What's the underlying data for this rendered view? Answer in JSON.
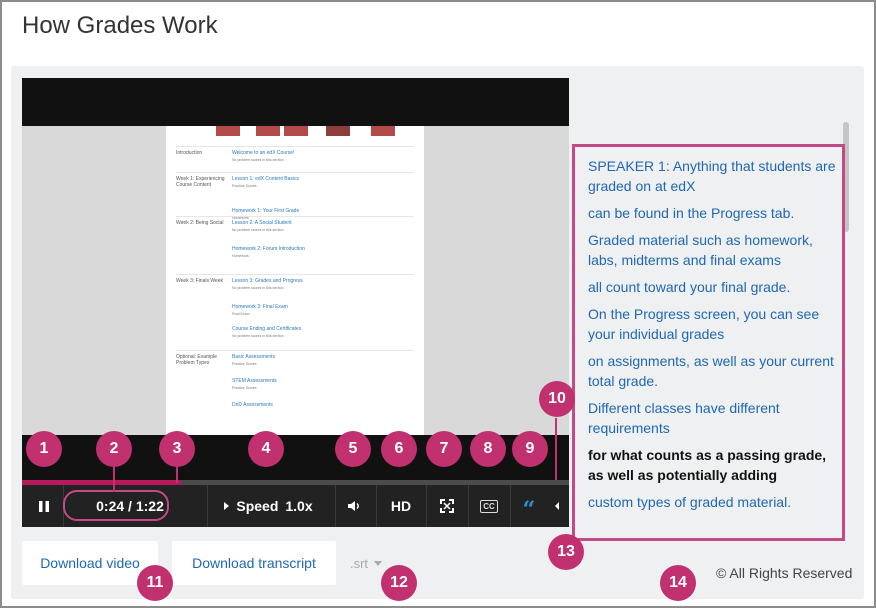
{
  "page": {
    "title": "How Grades Work"
  },
  "video": {
    "page_rows": [
      {
        "section": "Introduction",
        "link": "Welcome to an edX Course!",
        "sub": "No problem scores in this section"
      },
      {
        "section": "Week 1: Experiencing Course Content",
        "link": "Lesson 1: edX Content Basics",
        "sub": "Practice Scores"
      },
      {
        "section": "",
        "link": "Homework 1: Your First Grade",
        "sub": "Homework"
      },
      {
        "section": "Week 2: Being Social",
        "link": "Lesson 2: A Social Student",
        "sub": "No problem scores in this section"
      },
      {
        "section": "",
        "link": "Homework 2: Forum Introduction",
        "sub": "Homework"
      },
      {
        "section": "Week 3: Finals Week",
        "link": "Lesson 3: Grades and Progress",
        "sub": "No problem scores in this section"
      },
      {
        "section": "",
        "link": "Homework 3: Final Exam",
        "sub": "Final Exam"
      },
      {
        "section": "",
        "link": "Course Ending and Certificates",
        "sub": "No problem scores in this section"
      },
      {
        "section": "Optional: Example Problem Types",
        "link": "Basic Assessments",
        "sub": "Practice Scores"
      },
      {
        "section": "",
        "link": "STEM Assessments",
        "sub": "Practice Scores"
      },
      {
        "section": "",
        "link": "DnD Assessments",
        "sub": ""
      }
    ]
  },
  "player": {
    "progress": 0.29,
    "time_display": "0:24 / 1:22",
    "speed_label": "Speed",
    "speed_value": "1.0x",
    "hd_label": "HD",
    "cc_label": "CC",
    "quote_glyph": "“",
    "icons": [
      "pause-icon",
      "volume-icon",
      "fullscreen-icon",
      "chevron-left-icon"
    ]
  },
  "transcript": {
    "lines": [
      {
        "text": "SPEAKER 1: Anything that students are graded on at edX",
        "active": false
      },
      {
        "text": "can be found in the Progress tab.",
        "active": false
      },
      {
        "text": "Graded material such as homework, labs, midterms and final exams",
        "active": false
      },
      {
        "text": "all count toward your final grade.",
        "active": false
      },
      {
        "text": "On the Progress screen, you can see your individual grades",
        "active": false
      },
      {
        "text": "on assignments, as well as your current total grade.",
        "active": false
      },
      {
        "text": "Different classes have different requirements",
        "active": false
      },
      {
        "text": "for what counts as a passing grade, as well as potentially adding",
        "active": true
      },
      {
        "text": "custom types of graded material.",
        "active": false
      }
    ]
  },
  "downloads": {
    "video_label": "Download video",
    "transcript_label": "Download transcript",
    "format": ".srt"
  },
  "footer": {
    "copyright": "© All Rights Reserved"
  },
  "callouts": [
    "1",
    "2",
    "3",
    "4",
    "5",
    "6",
    "7",
    "8",
    "9",
    "10",
    "11",
    "12",
    "13",
    "14"
  ],
  "colors": {
    "accent": "#c1306f",
    "link": "#1f67b4",
    "controls": "#222222"
  }
}
